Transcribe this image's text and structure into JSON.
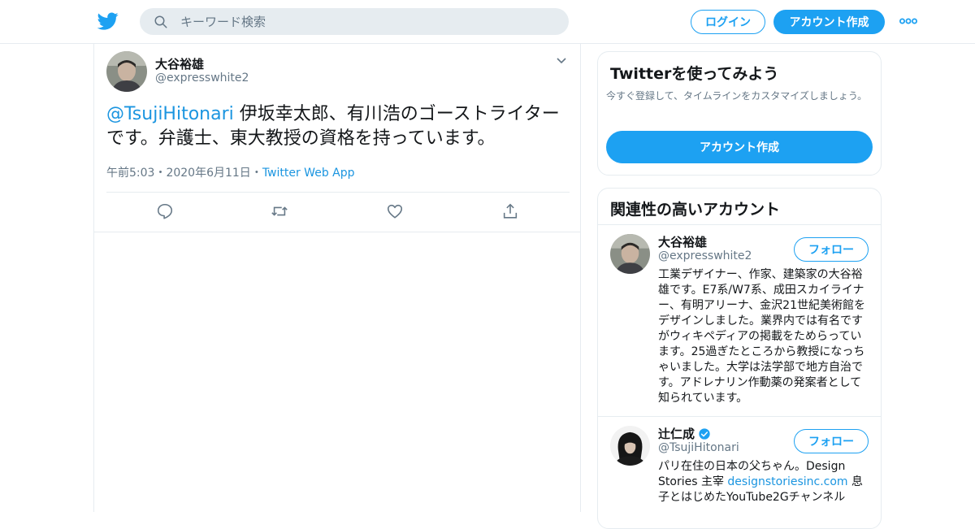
{
  "topbar": {
    "search_placeholder": "キーワード検索",
    "login_label": "ログイン",
    "signup_label": "アカウント作成"
  },
  "tweet": {
    "author_name": "大谷裕雄",
    "author_handle": "@expresswhite2",
    "mention": "@TsujiHitonari",
    "text": " 伊坂幸太郎、有川浩のゴーストライターです。弁護士、東大教授の資格を持っています。",
    "time": "午前5:03",
    "sep1": "・",
    "date": "2020年6月11日",
    "sep2": "・",
    "source": "Twitter Web App"
  },
  "signup_card": {
    "title": "Twitterを使ってみよう",
    "subtitle": "今すぐ登録して、タイムラインをカスタマイズしましょう。",
    "button_label": "アカウント作成"
  },
  "related": {
    "title": "関連性の高いアカウント",
    "accounts": [
      {
        "name": "大谷裕雄",
        "handle": "@expresswhite2",
        "follow_label": "フォロー",
        "bio": "工業デザイナー、作家、建築家の大谷裕雄です。E7系/W7系、成田スカイライナー、有明アリーナ、金沢21世紀美術館をデザインしました。業界内では有名ですがウィキペディアの掲載をためらっています。25過ぎたところから教授になっちゃいました。大学は法学部で地方自治です。アドレナリン作動薬の発案者として知られています。"
      },
      {
        "name": "辻仁成",
        "handle": "@TsujiHitonari",
        "follow_label": "フォロー",
        "bio_pre": "パリ在住の日本の父ちゃん。Design Stories 主宰 ",
        "bio_link": "designstoriesinc.com",
        "bio_post": " 息子とはじめたYouTube2Gチャンネル"
      }
    ]
  },
  "colors": {
    "accent": "#1da1f2",
    "link": "#1b95e0",
    "muted": "#657786",
    "border": "#e6ecf0"
  },
  "icons": [
    "twitter-bird-icon",
    "search-icon",
    "more-dots-icon",
    "chevron-down-icon",
    "reply-icon",
    "retweet-icon",
    "like-icon",
    "share-icon",
    "verified-badge-icon"
  ]
}
